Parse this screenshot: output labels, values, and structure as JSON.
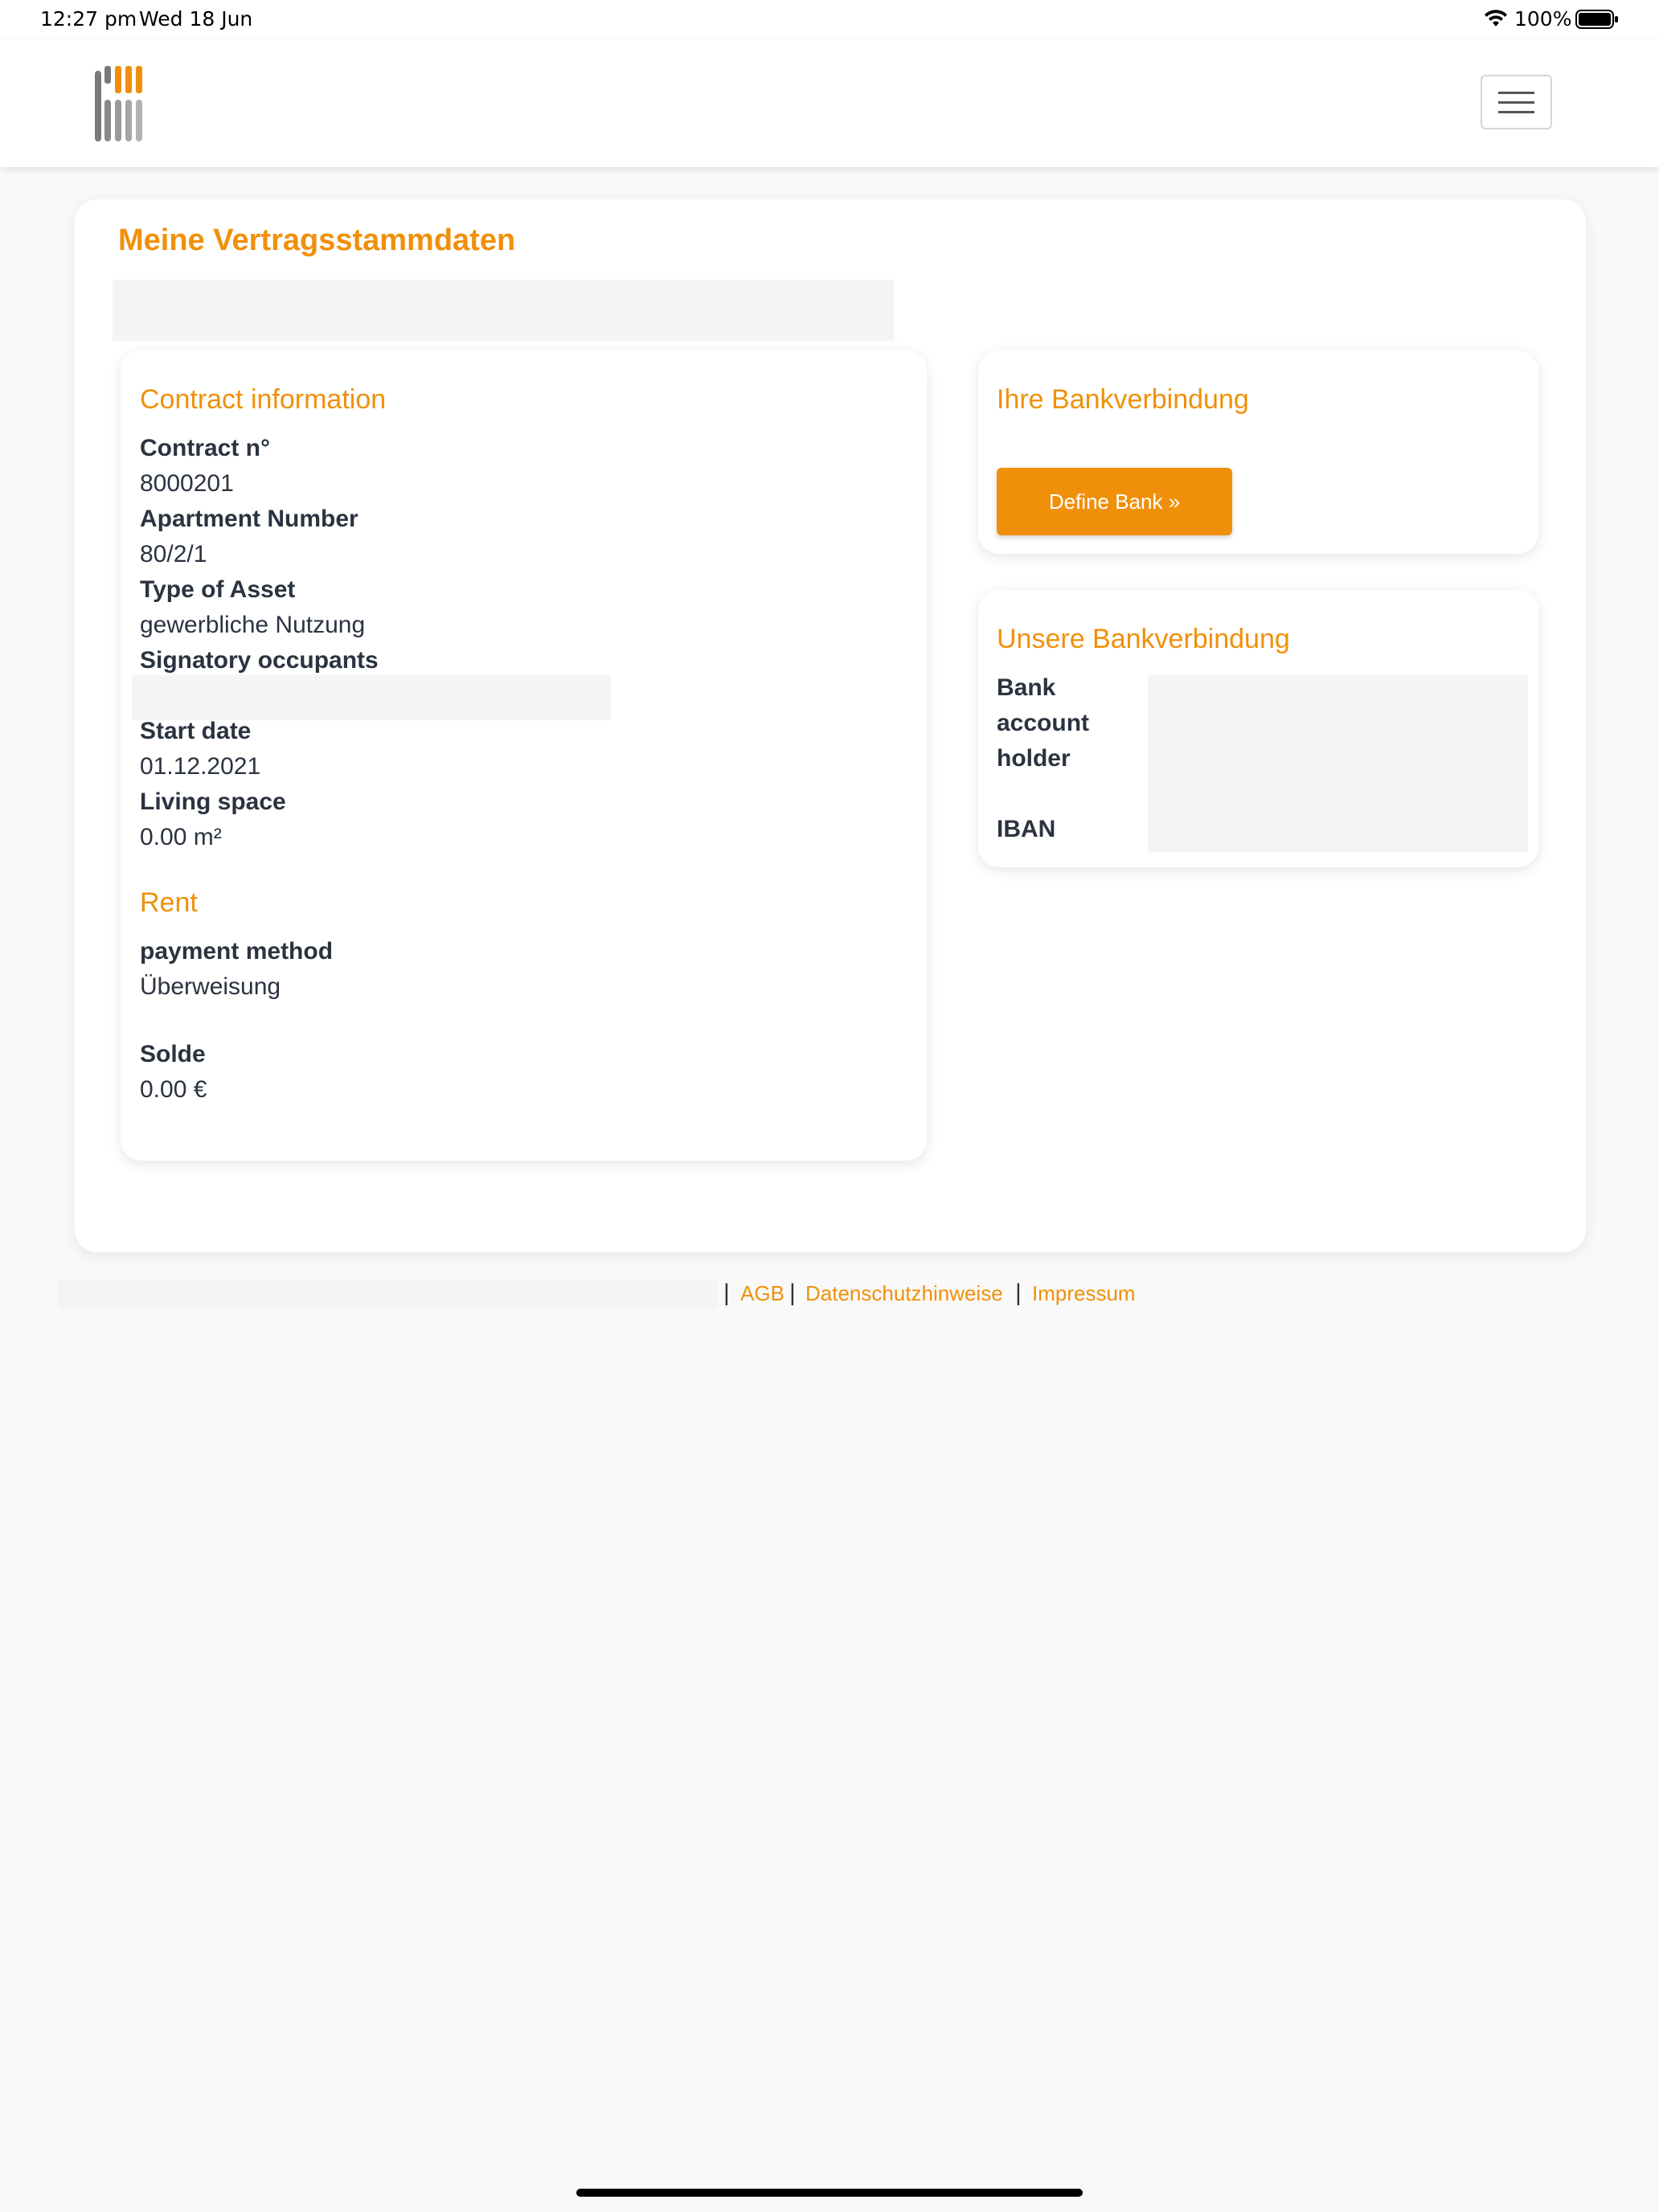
{
  "status_bar": {
    "time": "12:27 pm",
    "date": "Wed 18 Jun",
    "battery": "100%"
  },
  "header": {
    "logo_icon": "company-logo-icon",
    "menu_icon": "hamburger-menu-icon"
  },
  "page": {
    "title": "Meine Vertragsstammdaten"
  },
  "contract_card": {
    "title": "Contract information",
    "fields": [
      {
        "label": "Contract n°",
        "value": "8000201"
      },
      {
        "label": "Apartment Number",
        "value": "80/2/1"
      },
      {
        "label": "Type of Asset",
        "value": "gewerbliche Nutzung"
      },
      {
        "label": "Signatory occupants",
        "value": ""
      },
      {
        "label": "Start date",
        "value": "01.12.2021"
      },
      {
        "label": "Living space",
        "value": "0.00 m²"
      }
    ],
    "rent_title": "Rent",
    "payment_method_label": "payment method",
    "payment_method_value": "Überweisung",
    "solde_label": "Solde",
    "solde_value": "0.00 €"
  },
  "bank_card": {
    "title": "Ihre Bankverbindung",
    "button_label": "Define Bank »"
  },
  "our_bank_card": {
    "title": "Unsere Bankverbindung",
    "holder_label_line1": "Bank",
    "holder_label_line2": "account",
    "holder_label_line3": "holder",
    "iban_label": "IBAN"
  },
  "footer": {
    "links": [
      "AGB",
      "Datenschutzhinweise",
      "Impressum"
    ],
    "separator": "|"
  },
  "colors": {
    "accent": "#f0900a",
    "text": "#2b3340",
    "background": "#f9f9f9"
  }
}
